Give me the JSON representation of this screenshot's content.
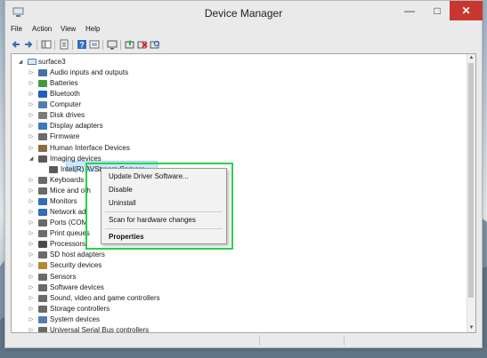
{
  "window": {
    "title": "Device Manager"
  },
  "window_controls": {
    "minimize": "—",
    "maximize": "□",
    "close": "✕"
  },
  "menu": [
    "File",
    "Action",
    "View",
    "Help"
  ],
  "toolbar_icons": [
    "back-icon",
    "forward-icon",
    "show-hide-console-tree-icon",
    "properties-icon",
    "help-icon",
    "view-icon",
    "display-icon",
    "update-driver-icon",
    "uninstall-icon",
    "scan-hardware-icon"
  ],
  "tree": {
    "root": "surface3",
    "categories": [
      {
        "label": "Audio inputs and outputs",
        "color": "#4a6fa5",
        "icon": "speaker-icon"
      },
      {
        "label": "Batteries",
        "color": "#3f9b3f",
        "icon": "battery-icon"
      },
      {
        "label": "Bluetooth",
        "color": "#1f5fbf",
        "icon": "bluetooth-icon"
      },
      {
        "label": "Computer",
        "color": "#4f7fb0",
        "icon": "computer-icon"
      },
      {
        "label": "Disk drives",
        "color": "#7a7a7a",
        "icon": "disk-icon"
      },
      {
        "label": "Display adapters",
        "color": "#3b7bbf",
        "icon": "display-adapter-icon"
      },
      {
        "label": "Firmware",
        "color": "#6b6b6b",
        "icon": "firmware-icon"
      },
      {
        "label": "Human Interface Devices",
        "color": "#8a6b3f",
        "icon": "hid-icon"
      },
      {
        "label": "Imaging devices",
        "color": "#5a5a5a",
        "icon": "camera-icon"
      },
      {
        "label": "Intel(R) AVStream Camera",
        "color": "#5a5a5a",
        "icon": "camera-icon"
      },
      {
        "label": "Keyboards",
        "color": "#6a6a6a",
        "icon": "keyboard-icon"
      },
      {
        "label": "Mice and oth",
        "color": "#6a6a6a",
        "icon": "mouse-icon"
      },
      {
        "label": "Monitors",
        "color": "#2f6fb5",
        "icon": "monitor-icon"
      },
      {
        "label": "Network ad",
        "color": "#2f6fb5",
        "icon": "network-icon"
      },
      {
        "label": "Ports (COM",
        "color": "#6a6a6a",
        "icon": "port-icon"
      },
      {
        "label": "Print queues",
        "color": "#6a6a6a",
        "icon": "printer-icon"
      },
      {
        "label": "Processors",
        "color": "#4a4a4a",
        "icon": "processor-icon"
      },
      {
        "label": "SD host adapters",
        "color": "#6a6a6a",
        "icon": "sd-icon"
      },
      {
        "label": "Security devices",
        "color": "#b58a2f",
        "icon": "security-icon"
      },
      {
        "label": "Sensors",
        "color": "#6a6a6a",
        "icon": "sensor-icon"
      },
      {
        "label": "Software devices",
        "color": "#6a6a6a",
        "icon": "software-icon"
      },
      {
        "label": "Sound, video and game controllers",
        "color": "#6a6a6a",
        "icon": "sound-icon"
      },
      {
        "label": "Storage controllers",
        "color": "#6a6a6a",
        "icon": "storage-icon"
      },
      {
        "label": "System devices",
        "color": "#4f7fb0",
        "icon": "system-icon"
      },
      {
        "label": "Universal Serial Bus controllers",
        "color": "#6a6a6a",
        "icon": "usb-icon"
      }
    ]
  },
  "context_menu": {
    "update_driver": "Update Driver Software...",
    "disable": "Disable",
    "uninstall": "Uninstall",
    "scan": "Scan for hardware changes",
    "properties": "Properties"
  },
  "accent": {
    "highlight_box": "#2bd14a",
    "selection": "#cce8ff",
    "close_button": "#c7372f"
  }
}
